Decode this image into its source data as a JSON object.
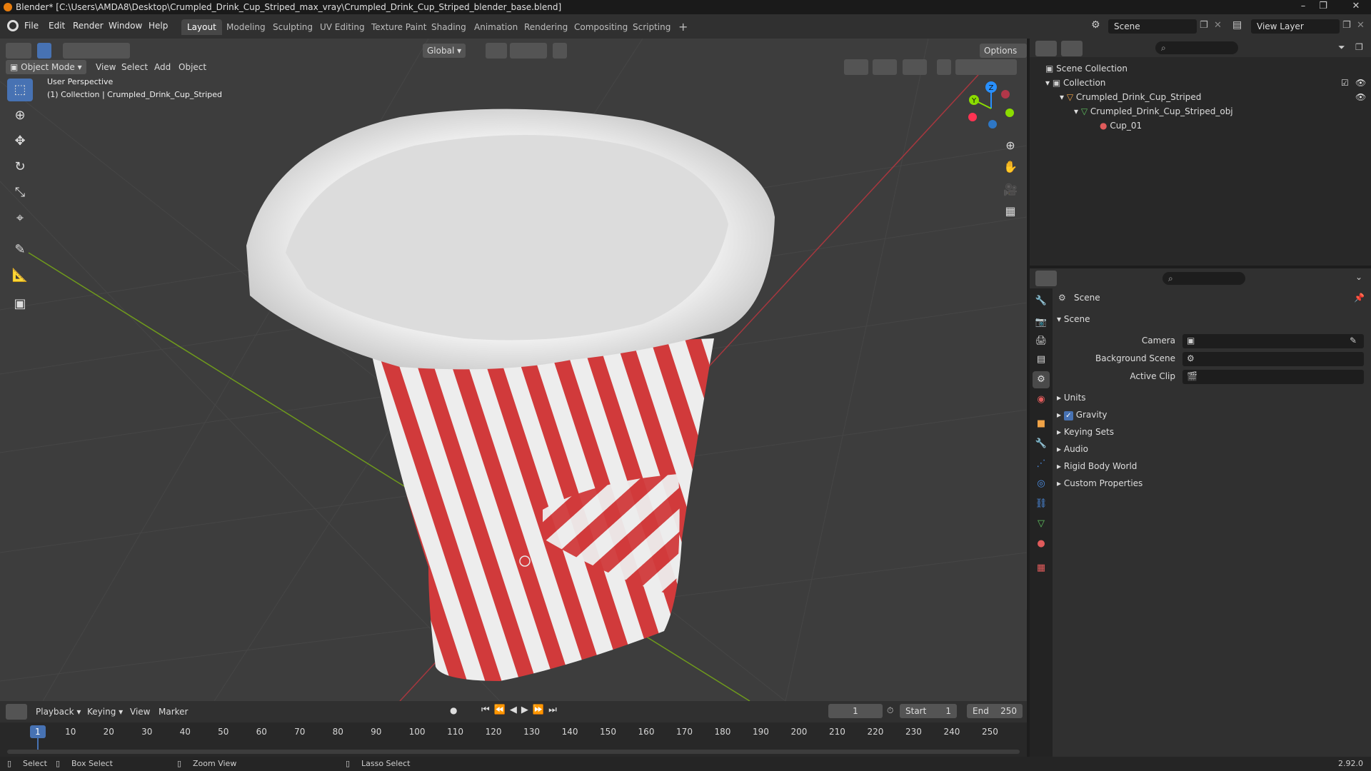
{
  "window": {
    "title": "Blender* [C:\\Users\\AMDA8\\Desktop\\Crumpled_Drink_Cup_Striped_max_vray\\Crumpled_Drink_Cup_Striped_blender_base.blend]",
    "controls": [
      "–",
      "❐",
      "✕"
    ]
  },
  "menubar": {
    "menus": [
      "File",
      "Edit",
      "Render",
      "Window",
      "Help"
    ],
    "workspaces": [
      "Layout",
      "Modeling",
      "Sculpting",
      "UV Editing",
      "Texture Paint",
      "Shading",
      "Animation",
      "Rendering",
      "Compositing",
      "Scripting"
    ],
    "active_workspace": "Layout",
    "add_tab": "+",
    "scene_name": "Scene",
    "view_layer": "View Layer"
  },
  "viewport_header": {
    "mode": "Object Mode",
    "menus": [
      "View",
      "Select",
      "Add",
      "Object"
    ],
    "transform_orientation": "Global",
    "options": "Options"
  },
  "viewport": {
    "overlay_line1": "User Perspective",
    "overlay_line2": "(1) Collection | Crumpled_Drink_Cup_Striped",
    "gizmo_axes": {
      "x": "X",
      "y": "Y",
      "z": "Z"
    },
    "colors": {
      "x_axis": "#ff3352",
      "y_axis": "#8bdc00",
      "z_axis": "#2890ff",
      "cup_red": "#d13a3b",
      "cup_white": "#ededed"
    }
  },
  "outliner": {
    "items": [
      {
        "label": "Scene Collection",
        "icon": "collection-icon"
      },
      {
        "label": "Collection",
        "icon": "collection-icon"
      },
      {
        "label": "Crumpled_Drink_Cup_Striped",
        "icon": "object-icon"
      },
      {
        "label": "Crumpled_Drink_Cup_Striped_obj",
        "icon": "mesh-icon"
      },
      {
        "label": "Cup_01",
        "icon": "material-icon"
      }
    ]
  },
  "properties": {
    "header": "Scene",
    "panel_title": "Scene",
    "fields": [
      {
        "label": "Camera",
        "value": ""
      },
      {
        "label": "Background Scene",
        "value": ""
      },
      {
        "label": "Active Clip",
        "value": ""
      }
    ],
    "sections": [
      "Units",
      "Gravity",
      "Keying Sets",
      "Audio",
      "Rigid Body World",
      "Custom Properties"
    ],
    "gravity_checked": true
  },
  "timeline": {
    "menus": [
      "Playback",
      "Keying",
      "View",
      "Marker"
    ],
    "current_frame": "1",
    "start_label": "Start",
    "start_value": "1",
    "end_label": "End",
    "end_value": "250",
    "ticks": [
      "1",
      "10",
      "20",
      "30",
      "40",
      "50",
      "60",
      "70",
      "80",
      "90",
      "100",
      "110",
      "120",
      "130",
      "140",
      "150",
      "160",
      "170",
      "180",
      "190",
      "200",
      "210",
      "220",
      "230",
      "240",
      "250"
    ]
  },
  "statusbar": {
    "items": [
      "Select",
      "Box Select",
      "Zoom View",
      "Lasso Select"
    ],
    "version": "2.92.0"
  }
}
